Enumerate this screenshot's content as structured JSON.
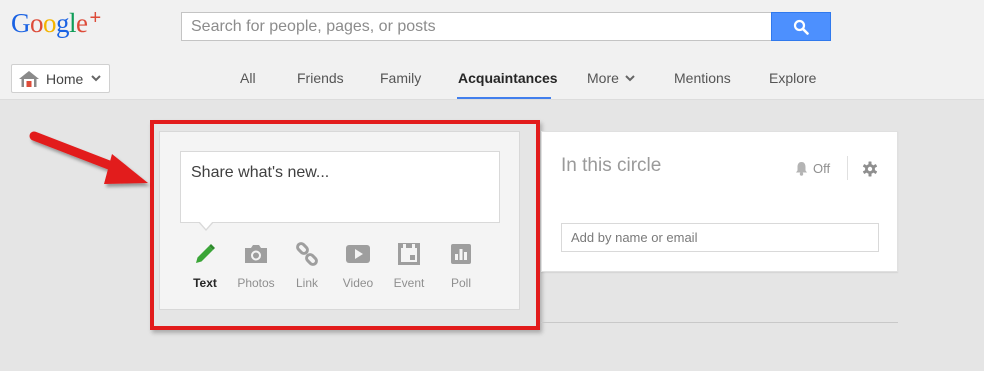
{
  "header": {
    "logo": {
      "letters": [
        {
          "ch": "G",
          "color": "#1a62e3"
        },
        {
          "ch": "o",
          "color": "#dd4b39"
        },
        {
          "ch": "o",
          "color": "#f4b400"
        },
        {
          "ch": "g",
          "color": "#1a62e3"
        },
        {
          "ch": "l",
          "color": "#0f9d58"
        },
        {
          "ch": "e",
          "color": "#dd4b39"
        }
      ],
      "plus": "+"
    },
    "search": {
      "placeholder": "Search for people, pages, or posts",
      "value": "",
      "icon": "search-icon"
    }
  },
  "nav": {
    "home_label": "Home",
    "tabs": [
      "All",
      "Friends",
      "Family",
      "Acquaintances",
      "More",
      "Mentions",
      "Explore"
    ],
    "active_tab": "Acquaintances"
  },
  "share": {
    "placeholder": "Share what's new...",
    "actions": [
      {
        "label": "Text",
        "icon": "pencil-icon",
        "active": true
      },
      {
        "label": "Photos",
        "icon": "camera-icon",
        "active": false
      },
      {
        "label": "Link",
        "icon": "link-icon",
        "active": false
      },
      {
        "label": "Video",
        "icon": "video-icon",
        "active": false
      },
      {
        "label": "Event",
        "icon": "calendar-icon",
        "active": false
      },
      {
        "label": "Poll",
        "icon": "poll-icon",
        "active": false
      }
    ]
  },
  "circle_card": {
    "title": "In this circle",
    "notifications": "Off",
    "add_placeholder": "Add by name or email"
  },
  "colors": {
    "accent_blue": "#4d90fe",
    "active_underline": "#427fed",
    "highlight_red": "#e21b1b",
    "text_action_green": "#3aa537"
  }
}
